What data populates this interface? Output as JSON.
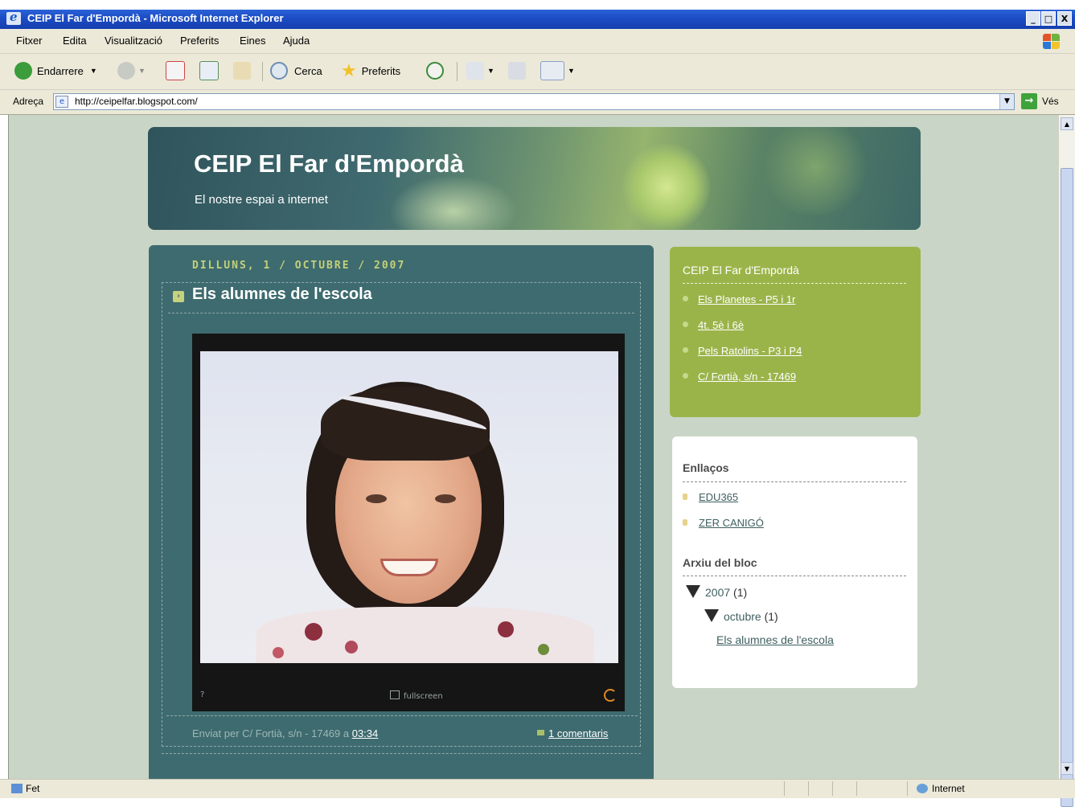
{
  "window": {
    "title": "CEIP El Far d'Empordà - Microsoft Internet Explorer",
    "controls": {
      "minimize": "_",
      "maximize": "□",
      "close": "X"
    }
  },
  "menu": {
    "items": [
      "Fitxer",
      "Edita",
      "Visualització",
      "Preferits",
      "Eines",
      "Ajuda"
    ]
  },
  "toolbar": {
    "back_label": "Endarrere",
    "search_label": "Cerca",
    "favorites_label": "Preferits"
  },
  "address": {
    "label": "Adreça",
    "url": "http://ceipelfar.blogspot.com/",
    "go_label": "Vés"
  },
  "blog": {
    "title": "CEIP El Far d'Empordà",
    "description": "El nostre espai a internet"
  },
  "post": {
    "date": "DILLUNS, 1 / OCTUBRE / 2007",
    "title": "Els alumnes de l'escola",
    "video_fullscreen": "fullscreen",
    "video_help": "?",
    "posted_by": "Enviat per C/ Fortià, s/n - 17469  a ",
    "time": "03:34",
    "comments": "1 comentaris"
  },
  "sidebar_green": {
    "heading": "CEIP El Far d'Empordà",
    "links": [
      "Els Planetes - P5 i 1r",
      "4t. 5è i 6è",
      "Pels Ratolins - P3 i P4",
      "C/ Fortià, s/n - 17469"
    ]
  },
  "sidebar_white": {
    "links_heading": "Enllaços",
    "links": [
      "EDU365",
      "ZER CANIGÓ"
    ],
    "archive_heading": "Arxiu del bloc",
    "archive_year": "2007",
    "archive_year_count": "(1)",
    "archive_month": "octubre",
    "archive_month_count": "(1)",
    "archive_post": "Els alumnes de l'escola"
  },
  "status": {
    "left": "Fet",
    "zone": "Internet"
  },
  "colors": {
    "xp_title_blue": "#1c4cc4",
    "post_panel": "#3e6b6f",
    "sidebar_green": "#9bb44a",
    "date_accent": "#c3d17a"
  }
}
